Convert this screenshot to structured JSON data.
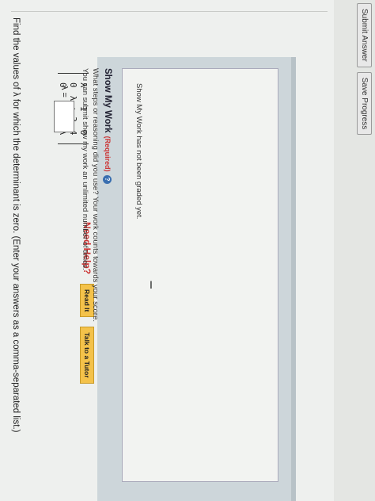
{
  "question": {
    "text": "Find the values of λ for which the determinant is zero. (Enter your answers as a comma-separated list.)"
  },
  "matrix": {
    "rows": [
      [
        "λ",
        "1",
        "0"
      ],
      [
        "0",
        "λ + 3",
        "4"
      ],
      [
        "0",
        "1",
        "λ"
      ]
    ]
  },
  "answer": {
    "label": "λ =",
    "value": ""
  },
  "help": {
    "label": "Need Help?",
    "read_it": "Read It",
    "talk_tutor": "Talk to a Tutor"
  },
  "show_work": {
    "title": "Show My Work",
    "required": "(Required)",
    "help_icon": "?",
    "line1": "What steps or reasoning did you use? Your work counts towards your score.",
    "line2": "You can submit show my work an unlimited number of times.",
    "graded": "Show My Work has not been graded yet."
  },
  "actions": {
    "submit": "Submit Answer",
    "save": "Save Progress"
  }
}
